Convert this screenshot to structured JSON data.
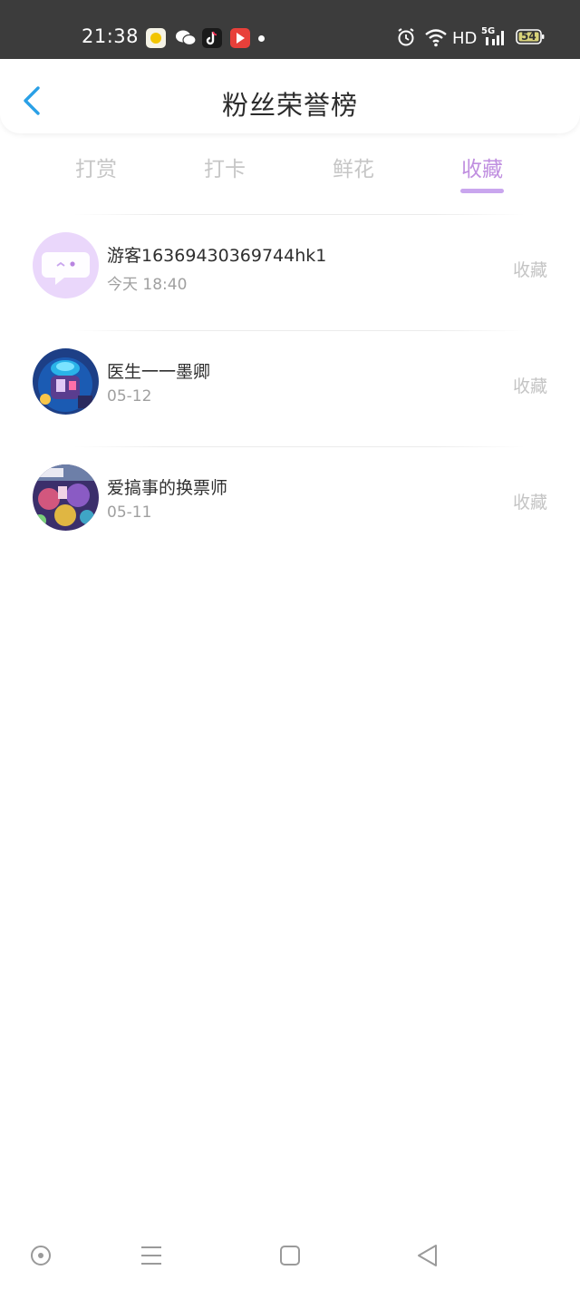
{
  "status_bar": {
    "time": "21:38",
    "network": "HD",
    "signal_type": "5G",
    "battery": "54",
    "icons": [
      "yellow-app-icon",
      "wechat-icon",
      "tiktok-icon",
      "video-app-icon",
      "notification-dot",
      "alarm-icon",
      "wifi-icon",
      "signal-icon",
      "battery-icon"
    ]
  },
  "header": {
    "title": "粉丝荣誉榜",
    "back_icon": "chevron-left-icon",
    "accent_color": "#2aa0e6"
  },
  "tabs": [
    {
      "label": "打赏",
      "active": false
    },
    {
      "label": "打卡",
      "active": false
    },
    {
      "label": "鲜花",
      "active": false
    },
    {
      "label": "收藏",
      "active": true
    }
  ],
  "accent_color": "#c08fe0",
  "fans": [
    {
      "name": "游客16369430369744hk1",
      "date": "今天 18:40",
      "action": "收藏",
      "avatar": "guest-chat-avatar"
    },
    {
      "name": "医生一一墨卿",
      "date": "05-12",
      "action": "收藏",
      "avatar": "user-avatar"
    },
    {
      "name": "爱搞事的换票师",
      "date": "05-11",
      "action": "收藏",
      "avatar": "user-avatar"
    }
  ],
  "nav_bar": {
    "icons": [
      "home-circle-icon",
      "menu-icon",
      "square-recent-icon",
      "back-triangle-icon"
    ]
  }
}
